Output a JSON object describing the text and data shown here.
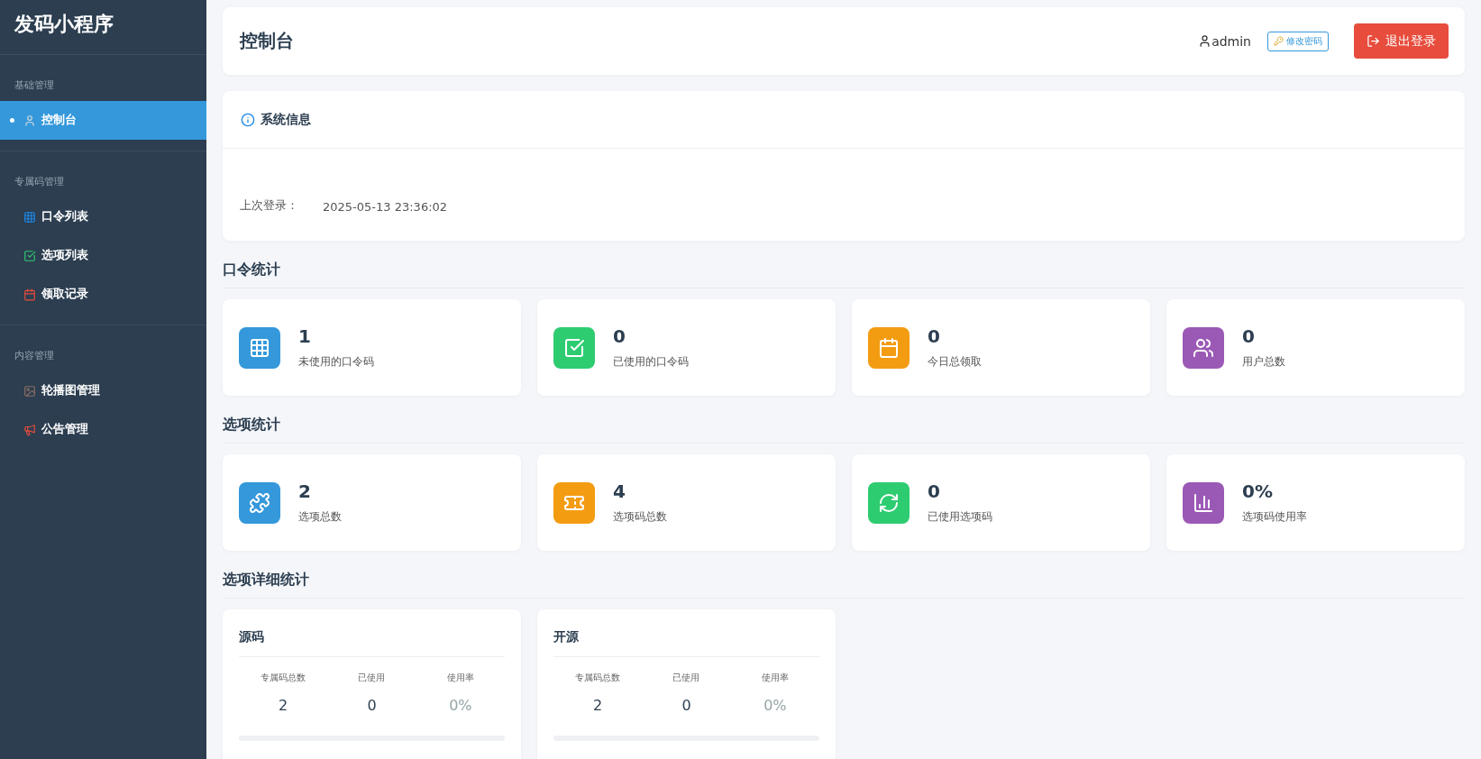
{
  "sidebar": {
    "title": "发码小程序",
    "sections": [
      {
        "label": "基础管理",
        "items": [
          {
            "label": "控制台",
            "selected": true
          }
        ]
      },
      {
        "label": "专属码管理",
        "items": [
          {
            "label": "口令列表",
            "selected": false
          },
          {
            "label": "选项列表",
            "selected": false
          },
          {
            "label": "领取记录",
            "selected": false
          }
        ]
      },
      {
        "label": "内容管理",
        "items": [
          {
            "label": "轮播图管理",
            "selected": false
          },
          {
            "label": "公告管理",
            "selected": false
          }
        ]
      }
    ]
  },
  "header": {
    "title": "控制台",
    "user": "admin",
    "change_password": "修改密码",
    "logout": "退出登录"
  },
  "system_info": {
    "title": "系统信息",
    "rows": [
      {
        "label": "上次登录：",
        "value": "2025-05-13 23:36:02"
      }
    ]
  },
  "code_stats": {
    "title": "口令统计",
    "cards": [
      {
        "value": "1",
        "label": "未使用的口令码",
        "color": "#3498db"
      },
      {
        "value": "0",
        "label": "已使用的口令码",
        "color": "#2ecc71"
      },
      {
        "value": "0",
        "label": "今日总领取",
        "color": "#f39c12"
      },
      {
        "value": "0",
        "label": "用户总数",
        "color": "#9b59b6"
      }
    ]
  },
  "option_stats": {
    "title": "选项统计",
    "cards": [
      {
        "value": "2",
        "label": "选项总数",
        "color": "#3498db"
      },
      {
        "value": "4",
        "label": "选项码总数",
        "color": "#f39c12"
      },
      {
        "value": "0",
        "label": "已使用选项码",
        "color": "#2ecc71"
      },
      {
        "value": "0%",
        "label": "选项码使用率",
        "color": "#9b59b6"
      }
    ]
  },
  "option_details": {
    "title": "选项详细统计",
    "cards": [
      {
        "name": "源码",
        "columns": [
          "专属码总数",
          "已使用",
          "使用率"
        ],
        "values": [
          "2",
          "0",
          "0%"
        ]
      },
      {
        "name": "开源",
        "columns": [
          "专属码总数",
          "已使用",
          "使用率"
        ],
        "values": [
          "2",
          "0",
          "0%"
        ]
      }
    ]
  }
}
